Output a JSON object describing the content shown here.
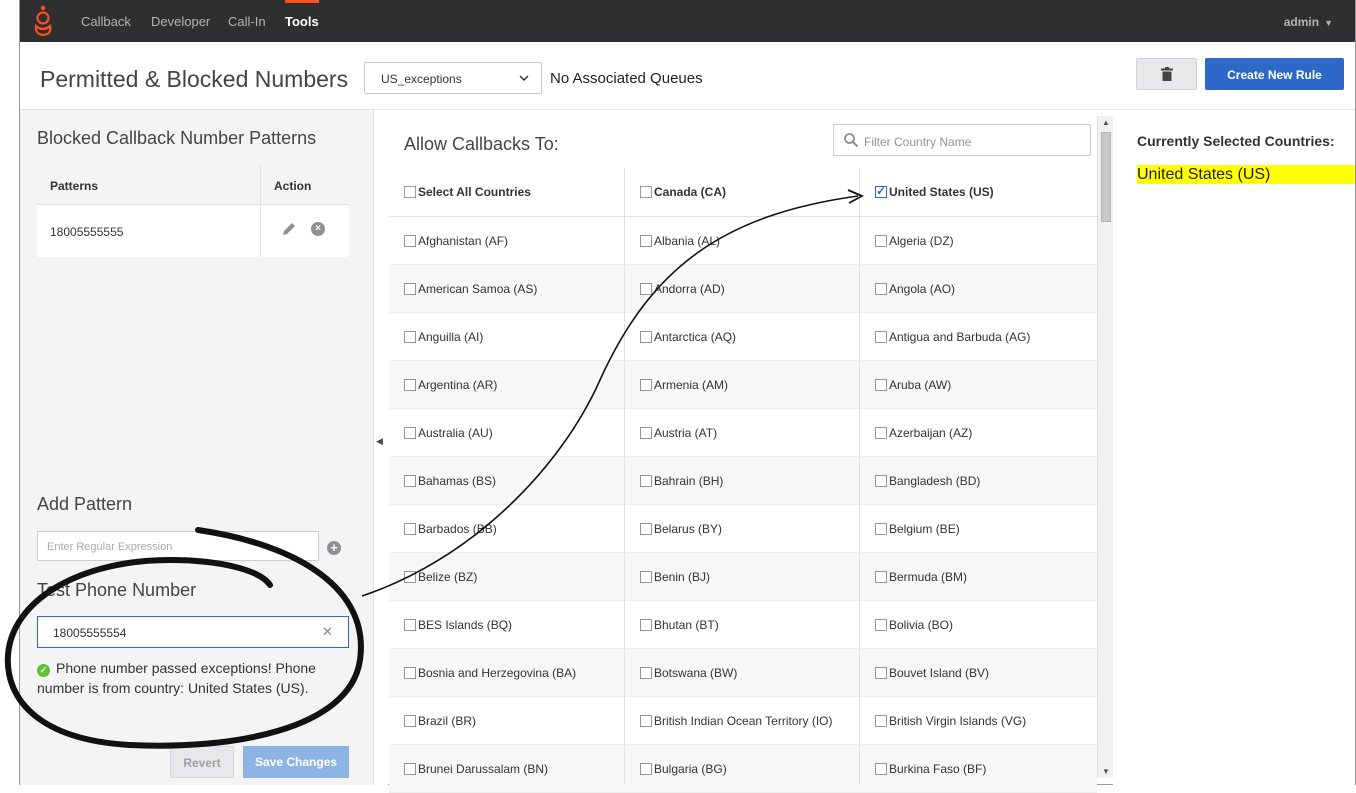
{
  "nav": {
    "items": [
      {
        "label": "Callback",
        "active": false
      },
      {
        "label": "Developer",
        "active": false
      },
      {
        "label": "Call-In",
        "active": false
      },
      {
        "label": "Tools",
        "active": true
      }
    ],
    "user": "admin"
  },
  "header": {
    "title": "Permitted & Blocked Numbers",
    "rule_select": "US_exceptions",
    "queues_text": "No Associated Queues",
    "create_label": "Create New Rule"
  },
  "blocked": {
    "title": "Blocked Callback Number Patterns",
    "col_patterns": "Patterns",
    "col_action": "Action",
    "rows": [
      "18005555555"
    ]
  },
  "add_pattern": {
    "title": "Add Pattern",
    "placeholder": "Enter Regular Expression"
  },
  "test": {
    "title": "Test Phone Number",
    "value": "18005555554",
    "message": "Phone number passed exceptions! Phone number is from country: United States (US)."
  },
  "buttons": {
    "revert": "Revert",
    "save": "Save Changes"
  },
  "allow": {
    "title": "Allow Callbacks To:",
    "filter_placeholder": "Filter Country Name",
    "header": [
      {
        "label": "Select All Countries",
        "checked": false
      },
      {
        "label": "Canada (CA)",
        "checked": false
      },
      {
        "label": "United States (US)",
        "checked": true
      }
    ],
    "rows": [
      [
        "Afghanistan (AF)",
        "Albania (AL)",
        "Algeria (DZ)"
      ],
      [
        "American Samoa (AS)",
        "Andorra (AD)",
        "Angola (AO)"
      ],
      [
        "Anguilla (AI)",
        "Antarctica (AQ)",
        "Antigua and Barbuda (AG)"
      ],
      [
        "Argentina (AR)",
        "Armenia (AM)",
        "Aruba (AW)"
      ],
      [
        "Australia (AU)",
        "Austria (AT)",
        "Azerbaijan (AZ)"
      ],
      [
        "Bahamas (BS)",
        "Bahrain (BH)",
        "Bangladesh (BD)"
      ],
      [
        "Barbados (BB)",
        "Belarus (BY)",
        "Belgium (BE)"
      ],
      [
        "Belize (BZ)",
        "Benin (BJ)",
        "Bermuda (BM)"
      ],
      [
        "BES Islands (BQ)",
        "Bhutan (BT)",
        "Bolivia (BO)"
      ],
      [
        "Bosnia and Herzegovina (BA)",
        "Botswana (BW)",
        "Bouvet Island (BV)"
      ],
      [
        "Brazil (BR)",
        "British Indian Ocean Territory (IO)",
        "British Virgin Islands (VG)"
      ],
      [
        "Brunei Darussalam (BN)",
        "Bulgaria (BG)",
        "Burkina Faso (BF)"
      ]
    ]
  },
  "selected": {
    "title": "Currently Selected Countries:",
    "items": [
      "United States (US)"
    ]
  },
  "colors": {
    "nav_bg": "#2d2f30",
    "accent": "#2e69c8",
    "brand": "#ff4f1f",
    "highlight": "#ffff00",
    "success": "#5ec12d"
  },
  "icons": [
    "genesys-logo-icon",
    "chevron-down-icon",
    "trash-icon",
    "pencil-icon",
    "remove-circle-icon",
    "add-circle-icon",
    "clear-icon",
    "check-circle-icon",
    "search-icon"
  ]
}
